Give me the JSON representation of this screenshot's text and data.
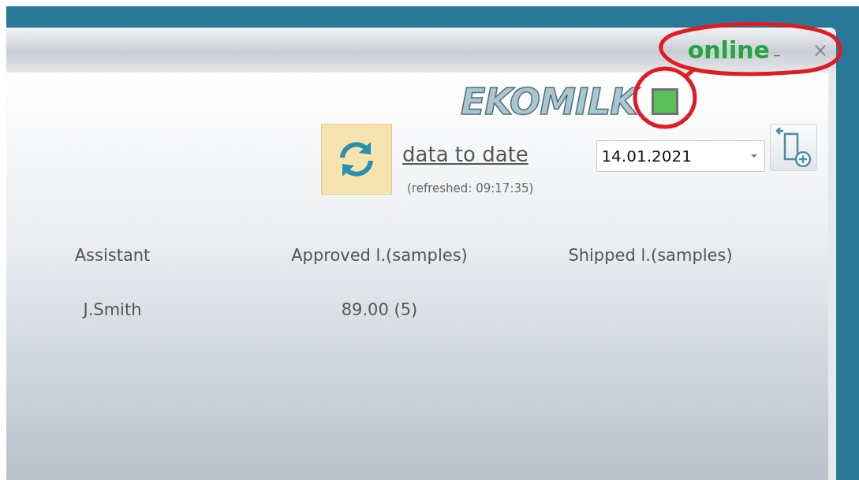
{
  "window": {
    "status_text": "online",
    "minimize": "–",
    "close": "×"
  },
  "logo": "EKOMILK",
  "connection": {
    "online": true
  },
  "refresh": {
    "link": "data to date",
    "refreshed": "(refreshed: 09:17:35)"
  },
  "date_field": {
    "value": "14.01.2021"
  },
  "table": {
    "columns": [
      "Assistant",
      "Approved l.(samples)",
      "Shipped l.(samples)"
    ],
    "rows": [
      [
        "J.Smith",
        "89.00 (5)"
      ]
    ]
  }
}
